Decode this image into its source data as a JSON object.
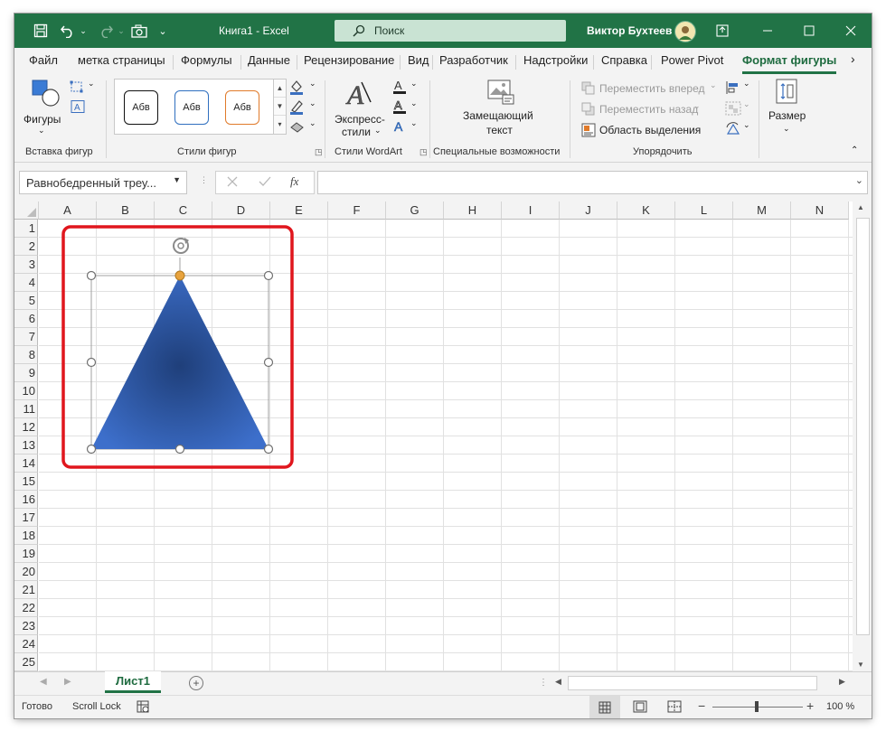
{
  "titlebar": {
    "doc_title": "Книга1  -  Excel",
    "search_label": "Поиск",
    "user_name": "Виктор Бухтеев"
  },
  "tabs": [
    {
      "label": "Файл"
    },
    {
      "label": "метка страницы"
    },
    {
      "label": "Формулы"
    },
    {
      "label": "Данные"
    },
    {
      "label": "Рецензирование"
    },
    {
      "label": "Вид"
    },
    {
      "label": "Разработчик"
    },
    {
      "label": "Надстройки"
    },
    {
      "label": "Справка"
    },
    {
      "label": "Power Pivot"
    },
    {
      "label": "Формат фигуры"
    }
  ],
  "ribbon": {
    "insert_shapes": {
      "shapes_label": "Фигуры",
      "group_label": "Вставка фигур"
    },
    "shape_styles": {
      "sample_text": "Абв",
      "group_label": "Стили фигур"
    },
    "wordart": {
      "quick_styles_line1": "Экспресс-",
      "quick_styles_line2": "стили",
      "group_label": "Стили WordArt"
    },
    "accessibility": {
      "alt_text_line1": "Замещающий",
      "alt_text_line2": "текст",
      "group_label": "Специальные возможности"
    },
    "arrange": {
      "bring_forward": "Переместить вперед",
      "send_backward": "Переместить назад",
      "selection_pane": "Область выделения",
      "group_label": "Упорядочить"
    },
    "size": {
      "label": "Размер"
    }
  },
  "formula_bar": {
    "name_box": "Равнобедренный треу...",
    "fx": "fx",
    "formula": ""
  },
  "grid": {
    "columns": [
      "A",
      "B",
      "C",
      "D",
      "E",
      "F",
      "G",
      "H",
      "I",
      "J",
      "K",
      "L",
      "M",
      "N"
    ],
    "rows": [
      "1",
      "2",
      "3",
      "4",
      "5",
      "6",
      "7",
      "8",
      "9",
      "10",
      "11",
      "12",
      "13",
      "14",
      "15",
      "16",
      "17",
      "18",
      "19",
      "20",
      "21",
      "22",
      "23",
      "24",
      "25"
    ]
  },
  "shape": {
    "type": "isosceles-triangle",
    "fill": "#2f5aa8",
    "fill_dark": "#1f3f7a",
    "highlight_color": "#e0161d",
    "handle_color": "#e8a33d"
  },
  "sheets": [
    {
      "label": "Лист1",
      "active": true
    }
  ],
  "status": {
    "ready": "Готово",
    "scroll_lock": "Scroll Lock",
    "zoom": "100 %"
  },
  "colors": {
    "accent": "#217346",
    "active_tab": "#1e6b3f"
  }
}
